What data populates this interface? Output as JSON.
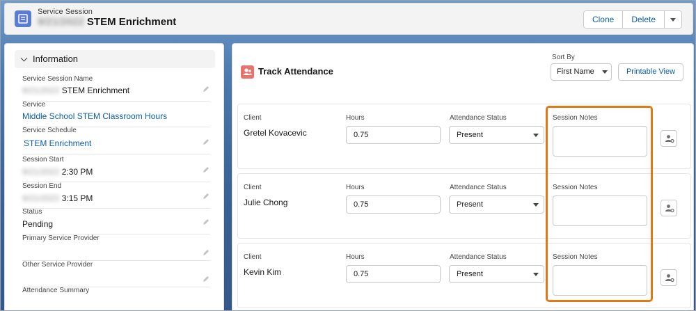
{
  "header": {
    "object_type": "Service Session",
    "title_blurred": "9/21/2022",
    "title": "STEM Enrichment",
    "buttons": [
      "Clone",
      "Delete"
    ],
    "icon": "service-session-icon"
  },
  "information": {
    "section_title": "Information",
    "fields": [
      {
        "label": "Service Session Name",
        "blurred": "9/21/2022",
        "value": "STEM Enrichment",
        "link": false
      },
      {
        "label": "Service",
        "blurred": "",
        "value": "Middle School STEM Classroom Hours",
        "link": true
      },
      {
        "label": "Service Schedule",
        "blurred": "",
        "value": "STEM Enrichment",
        "link": true
      },
      {
        "label": "Session Start",
        "blurred": "9/21/2022",
        "value": "2:30 PM",
        "link": false
      },
      {
        "label": "Session End",
        "blurred": "9/21/2022",
        "value": "3:15 PM",
        "link": false
      },
      {
        "label": "Status",
        "blurred": "",
        "value": "Pending",
        "link": false
      },
      {
        "label": "Primary Service Provider",
        "blurred": "",
        "value": "",
        "link": false
      },
      {
        "label": "Other Service Provider",
        "blurred": "",
        "value": "",
        "link": false
      },
      {
        "label": "Attendance Summary",
        "blurred": "",
        "value": "",
        "link": false
      }
    ]
  },
  "attendance": {
    "title": "Track Attendance",
    "sort_by_label": "Sort By",
    "sort_by_value": "First Name",
    "printable_view": "Printable View",
    "col_client": "Client",
    "col_hours": "Hours",
    "col_status": "Attendance Status",
    "col_notes": "Session Notes",
    "rows": [
      {
        "client": "Gretel Kovacevic",
        "hours": "0.75",
        "status": "Present",
        "notes": ""
      },
      {
        "client": "Julie Chong",
        "hours": "0.75",
        "status": "Present",
        "notes": ""
      },
      {
        "client": "Kevin Kim",
        "hours": "0.75",
        "status": "Present",
        "notes": ""
      }
    ]
  },
  "colors": {
    "accent_link": "#0b5cab",
    "highlight": "#e07a18",
    "header_icon": "#5a7bd6",
    "attendance_icon": "#e8736c"
  }
}
